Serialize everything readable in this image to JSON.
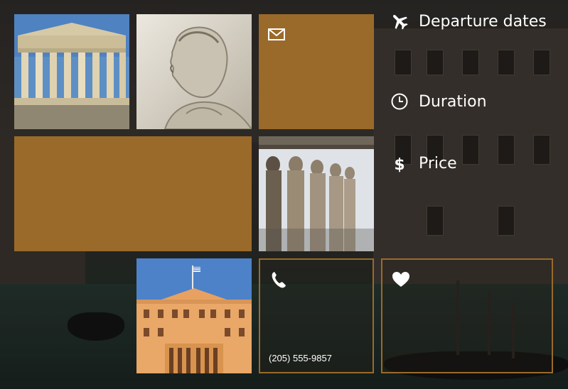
{
  "menu": {
    "items": [
      {
        "label": "Departure dates",
        "icon": "airplane-icon"
      },
      {
        "label": "Duration",
        "icon": "clock-icon"
      },
      {
        "label": "Price",
        "icon": "dollar-icon"
      }
    ]
  },
  "tiles": {
    "mail": {
      "icon": "mail-icon"
    },
    "phone": {
      "icon": "phone-icon",
      "number": "(205) 555-9857"
    },
    "favorite": {
      "icon": "heart-icon"
    }
  },
  "colors": {
    "accent": "#9a6a2b",
    "text": "#ffffff"
  }
}
